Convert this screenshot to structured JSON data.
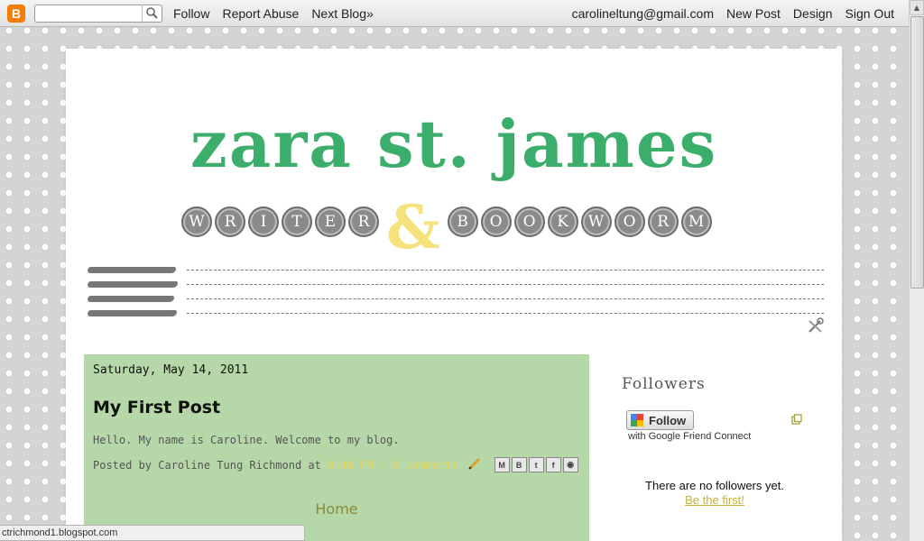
{
  "navbar": {
    "logo_icon": "blogger-icon",
    "search": {
      "value": "",
      "placeholder": ""
    },
    "left_links": [
      "Follow",
      "Report Abuse",
      "Next Blog»"
    ],
    "user_email": "carolineltung@gmail.com",
    "right_links": [
      "New Post",
      "Design",
      "Sign Out"
    ]
  },
  "header": {
    "title": "zara st. james",
    "subtitle_left": [
      "W",
      "R",
      "I",
      "T",
      "E",
      "R"
    ],
    "ampersand": "&",
    "subtitle_right": [
      "B",
      "O",
      "O",
      "K",
      "W",
      "O",
      "R",
      "M"
    ]
  },
  "colors": {
    "title_green": "#3cae6c",
    "ampersand_yellow": "#f5e27d",
    "post_background": "#b6d7a8",
    "link_yellow": "#e8d35a"
  },
  "post": {
    "date": "Saturday, May 14, 2011",
    "title": "My First Post",
    "body": "Hello. My name is Caroline. Welcome to my blog.",
    "posted_by_prefix": "Posted by Caroline Tung Richmond at",
    "time": "9:46 PM",
    "separator": "·",
    "comments": "0 comments",
    "share_buttons": [
      "email-icon",
      "blogthis-icon",
      "twitter-icon",
      "facebook-icon",
      "buzz-icon"
    ]
  },
  "home_link": "Home",
  "sidebar": {
    "followers_title": "Followers",
    "follow_button": "Follow",
    "gfc_note": "with Google Friend Connect",
    "no_followers": "There are no followers yet.",
    "be_first": "Be the first!"
  },
  "status_bar": "ctrichmond1.blogspot.com"
}
